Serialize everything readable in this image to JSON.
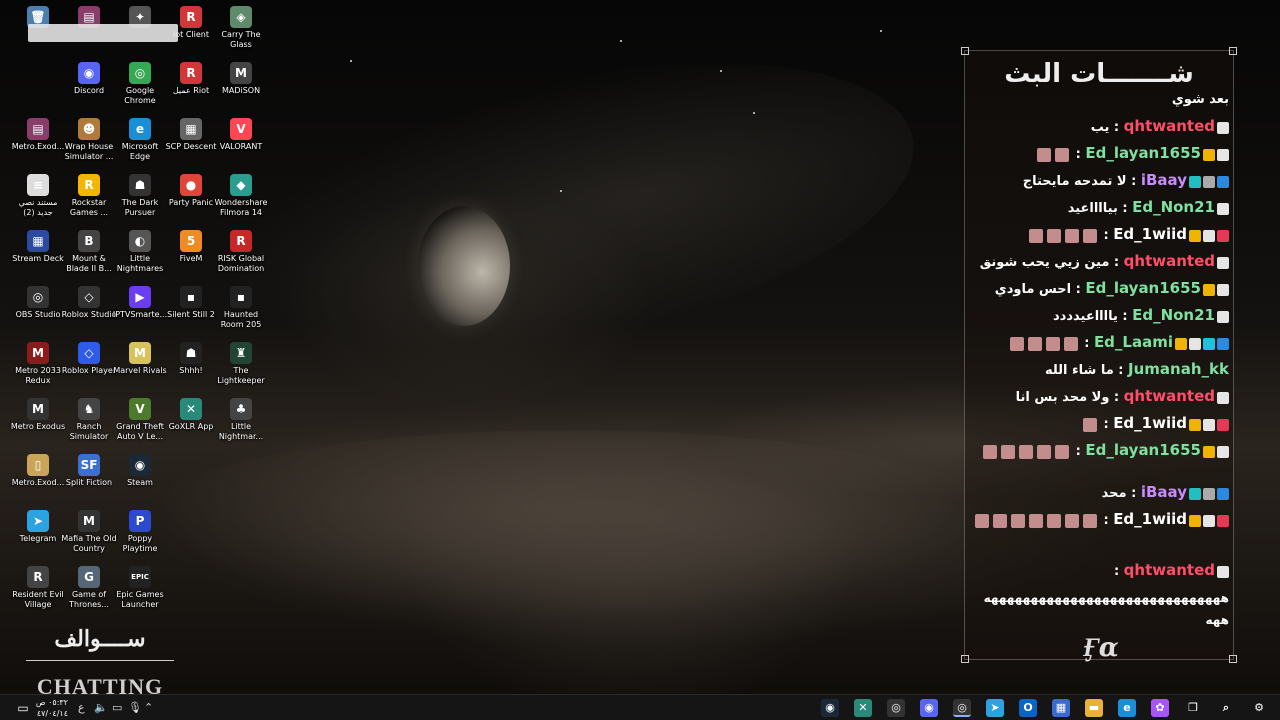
{
  "desktop_icons": [
    {
      "label": "",
      "name": "recycle-bin-icon",
      "glyph": "🗑",
      "color": "#4a7fb0"
    },
    {
      "label": "",
      "name": "winrar-icon",
      "glyph": "▤",
      "color": "#8b3d6a"
    },
    {
      "label": "",
      "name": "app-icon",
      "glyph": "✦",
      "color": "#555555"
    },
    {
      "label": "iot Client",
      "name": "riot-client-icon",
      "glyph": "R",
      "color": "#d13639"
    },
    {
      "label": "Carry The Glass",
      "name": "carry-the-glass-icon",
      "glyph": "◈",
      "color": "#5f8a6a"
    },
    {
      "label": "Discord",
      "name": "discord-icon",
      "glyph": "◉",
      "color": "#5865f2"
    },
    {
      "label": "Google Chrome",
      "name": "chrome-icon",
      "glyph": "◎",
      "color": "#34a853"
    },
    {
      "label": "عميل Riot",
      "name": "riot-client-ar-icon",
      "glyph": "R",
      "color": "#d13639"
    },
    {
      "label": "MADiSON",
      "name": "madison-icon",
      "glyph": "M",
      "color": "#444444"
    },
    {
      "label": "Metro.Exod...",
      "name": "metro-exodus-rar-icon",
      "glyph": "▤",
      "color": "#8b3d6a"
    },
    {
      "label": "Wrap House Simulator ...",
      "name": "wrap-house-icon",
      "glyph": "☻",
      "color": "#b07a3a"
    },
    {
      "label": "Microsoft Edge",
      "name": "edge-icon",
      "glyph": "e",
      "color": "#1a8fd8"
    },
    {
      "label": "SCP Descent",
      "name": "scp-descent-icon",
      "glyph": "▦",
      "color": "#666666"
    },
    {
      "label": "VALORANT",
      "name": "valorant-icon",
      "glyph": "V",
      "color": "#ff4655"
    },
    {
      "label": "مستند نصي جديد (2)",
      "name": "text-document-icon",
      "glyph": "≡",
      "color": "#dddddd"
    },
    {
      "label": "Rockstar Games ...",
      "name": "rockstar-icon",
      "glyph": "R",
      "color": "#f2b705"
    },
    {
      "label": "The Dark Pursuer",
      "name": "dark-pursuer-icon",
      "glyph": "☗",
      "color": "#333333"
    },
    {
      "label": "Party Panic",
      "name": "party-panic-icon",
      "glyph": "●",
      "color": "#e0453a"
    },
    {
      "label": "Wondershare Filmora 14",
      "name": "filmora-icon",
      "glyph": "◆",
      "color": "#2a9d8f"
    },
    {
      "label": "Stream Deck",
      "name": "stream-deck-icon",
      "glyph": "▦",
      "color": "#2b4aa0"
    },
    {
      "label": "Mount & Blade II B...",
      "name": "mount-blade-icon",
      "glyph": "B",
      "color": "#444444"
    },
    {
      "label": "Little Nightmares",
      "name": "little-nightmares-icon",
      "glyph": "◐",
      "color": "#555555"
    },
    {
      "label": "FiveM",
      "name": "fivem-icon",
      "glyph": "5",
      "color": "#f08a24"
    },
    {
      "label": "RISK Global Domination",
      "name": "risk-icon",
      "glyph": "R",
      "color": "#c62828"
    },
    {
      "label": "OBS Studio",
      "name": "obs-icon",
      "glyph": "◎",
      "color": "#333333"
    },
    {
      "label": "Roblox Studio",
      "name": "roblox-studio-icon",
      "glyph": "◇",
      "color": "#333333"
    },
    {
      "label": "IPTVSmarte...",
      "name": "iptv-icon",
      "glyph": "▶",
      "color": "#6a3df0"
    },
    {
      "label": "Silent Still 2",
      "name": "silent-still-icon",
      "glyph": "▪",
      "color": "#222222"
    },
    {
      "label": "Haunted Room 205",
      "name": "haunted-room-icon",
      "glyph": "▪",
      "color": "#222222"
    },
    {
      "label": "Metro 2033 Redux",
      "name": "metro-2033-icon",
      "glyph": "M",
      "color": "#8a1c1c"
    },
    {
      "label": "Roblox Player",
      "name": "roblox-player-icon",
      "glyph": "◇",
      "color": "#2f5bea"
    },
    {
      "label": "Marvel Rivals",
      "name": "marvel-rivals-icon",
      "glyph": "M",
      "color": "#d8c35a"
    },
    {
      "label": "Shhh!",
      "name": "shhh-icon",
      "glyph": "☗",
      "color": "#222222"
    },
    {
      "label": "The Lightkeeper",
      "name": "lightkeeper-icon",
      "glyph": "♜",
      "color": "#224433"
    },
    {
      "label": "Metro Exodus",
      "name": "metro-exodus-icon",
      "glyph": "M",
      "color": "#333333"
    },
    {
      "label": "Ranch Simulator",
      "name": "ranch-simulator-icon",
      "glyph": "♞",
      "color": "#444444"
    },
    {
      "label": "Grand Theft Auto V Le...",
      "name": "gta-v-icon",
      "glyph": "V",
      "color": "#4a7a2a"
    },
    {
      "label": "GoXLR App",
      "name": "goxlr-icon",
      "glyph": "✕",
      "color": "#2a8a7a"
    },
    {
      "label": "Little Nightmar...",
      "name": "little-nightmares-2-icon",
      "glyph": "♣",
      "color": "#444444"
    },
    {
      "label": "Metro.Exod...",
      "name": "metro-exodus-file-icon",
      "glyph": "▯",
      "color": "#c9a55a"
    },
    {
      "label": "Split Fiction",
      "name": "split-fiction-icon",
      "glyph": "SF",
      "color": "#3d6fd0"
    },
    {
      "label": "Steam",
      "name": "steam-icon",
      "glyph": "◉",
      "color": "#1b2838"
    },
    {
      "label": "Telegram",
      "name": "telegram-icon",
      "glyph": "➤",
      "color": "#2aa3e0"
    },
    {
      "label": "Mafia The Old Country",
      "name": "mafia-icon",
      "glyph": "M",
      "color": "#333333"
    },
    {
      "label": "Poppy Playtime",
      "name": "poppy-playtime-icon",
      "glyph": "P",
      "color": "#2b4ad0"
    },
    {
      "label": "Resident Evil Village",
      "name": "resident-evil-icon",
      "glyph": "R",
      "color": "#444444"
    },
    {
      "label": "Game of Thrones...",
      "name": "game-of-thrones-icon",
      "glyph": "G",
      "color": "#556677"
    },
    {
      "label": "Epic Games Launcher",
      "name": "epic-games-icon",
      "glyph": "EPIC",
      "color": "#222222"
    }
  ],
  "overlay_left": {
    "sawalef": "ســــوالف",
    "chatting": "CHATTING"
  },
  "chat": {
    "title": "شـــــــات البث",
    "logo": "Ӻɑ",
    "messages": [
      {
        "user": "",
        "text": "بعد شوي",
        "ucolor": "#ffffff",
        "badges": []
      },
      {
        "user": "qhtwanted",
        "text": "يب",
        "ucolor": "#ff4d6a",
        "badges": [
          "#e5e5e5"
        ]
      },
      {
        "user": "Ed_layan1655",
        "text": "",
        "ucolor": "#7fe0a0",
        "badges": [
          "#e5e5e5",
          "#f0b400"
        ],
        "emotes": 2
      },
      {
        "user": "iBaay",
        "text": "لا تمدحه مايحتاج",
        "ucolor": "#c88bff",
        "badges": [
          "#2a8ae0",
          "#aaaaaa",
          "#20c0c0"
        ]
      },
      {
        "user": "Ed_Non21",
        "text": "بيااااعيد",
        "ucolor": "#7fe0a0",
        "badges": [
          "#e5e5e5"
        ]
      },
      {
        "user": "Ed_1wiid",
        "text": "",
        "ucolor": "#ffffff",
        "badges": [
          "#e53955",
          "#e5e5e5",
          "#f0b400"
        ],
        "emotes": 4
      },
      {
        "user": "qhtwanted",
        "text": "مين زيي يحب شونق",
        "ucolor": "#ff4d6a",
        "badges": [
          "#e5e5e5"
        ]
      },
      {
        "user": "Ed_layan1655",
        "text": "احس ماودي",
        "ucolor": "#7fe0a0",
        "badges": [
          "#e5e5e5",
          "#f0b400"
        ]
      },
      {
        "user": "Ed_Non21",
        "text": "يااااعيدددد",
        "ucolor": "#7fe0a0",
        "badges": [
          "#e5e5e5"
        ]
      },
      {
        "user": "Ed_Laami",
        "text": "",
        "ucolor": "#7fe0a0",
        "badges": [
          "#2a8ae0",
          "#20c0e0",
          "#e5e5e5",
          "#f0b400"
        ],
        "emotes": 4
      },
      {
        "user": "Jumanah_kk",
        "text": "ما شاء الله",
        "ucolor": "#7fe0a0",
        "badges": []
      },
      {
        "user": "qhtwanted",
        "text": "ولا محد بس انا",
        "ucolor": "#ff4d6a",
        "badges": [
          "#e5e5e5"
        ]
      },
      {
        "user": "Ed_1wiid",
        "text": "",
        "ucolor": "#ffffff",
        "badges": [
          "#e53955",
          "#e5e5e5",
          "#f0b400"
        ],
        "emotes": 1
      },
      {
        "user": "Ed_layan1655",
        "text": "",
        "ucolor": "#7fe0a0",
        "badges": [
          "#e5e5e5",
          "#f0b400"
        ],
        "emotes": 5
      },
      {
        "user": "iBaay",
        "text": "محد",
        "ucolor": "#c88bff",
        "badges": [
          "#2a8ae0",
          "#aaaaaa",
          "#20c0c0"
        ]
      },
      {
        "user": "Ed_1wiid",
        "text": "",
        "ucolor": "#ffffff",
        "badges": [
          "#e53955",
          "#e5e5e5",
          "#f0b400"
        ],
        "emotes": 8
      },
      {
        "user": "qhtwanted",
        "text": "",
        "ucolor": "#ff4d6a",
        "badges": [
          "#e5e5e5"
        ]
      },
      {
        "user": "",
        "text": "ههههههههههههههههههههههههههههههه",
        "ucolor": "#ffffff",
        "badges": []
      },
      {
        "user": "",
        "text": "ههه",
        "ucolor": "#ffffff",
        "badges": []
      }
    ]
  },
  "taskbar": {
    "time": "٠٥:٣٢ ص",
    "date": "٤٧/٠٤/١٤",
    "lang": "ع",
    "apps": [
      {
        "name": "steam-taskbar-icon",
        "glyph": "◉",
        "color": "#1b2838"
      },
      {
        "name": "goxlr-taskbar-icon",
        "glyph": "✕",
        "color": "#2a8a7a"
      },
      {
        "name": "obs-taskbar-icon",
        "glyph": "◎",
        "color": "#333333"
      },
      {
        "name": "discord-taskbar-icon",
        "glyph": "◉",
        "color": "#5865f2"
      },
      {
        "name": "chrome-taskbar-icon",
        "glyph": "◎",
        "color": "#34a853",
        "active": true
      },
      {
        "name": "telegram-taskbar-icon",
        "glyph": "➤",
        "color": "#2aa3e0"
      },
      {
        "name": "outlook-taskbar-icon",
        "glyph": "O",
        "color": "#0a64c2"
      },
      {
        "name": "store-taskbar-icon",
        "glyph": "▦",
        "color": "#3a6ad0"
      },
      {
        "name": "file-explorer-taskbar-icon",
        "glyph": "▬",
        "color": "#e8b23a"
      },
      {
        "name": "edge-taskbar-icon",
        "glyph": "e",
        "color": "#1a8fd8"
      },
      {
        "name": "copilot-taskbar-icon",
        "glyph": "✿",
        "color": "#a855f7"
      },
      {
        "name": "task-view-taskbar-icon",
        "glyph": "❐",
        "color": "#151515"
      },
      {
        "name": "search-taskbar-icon",
        "glyph": "⌕",
        "color": "#151515"
      },
      {
        "name": "widgets-taskbar-icon",
        "glyph": "⚙",
        "color": "#151515"
      }
    ]
  }
}
